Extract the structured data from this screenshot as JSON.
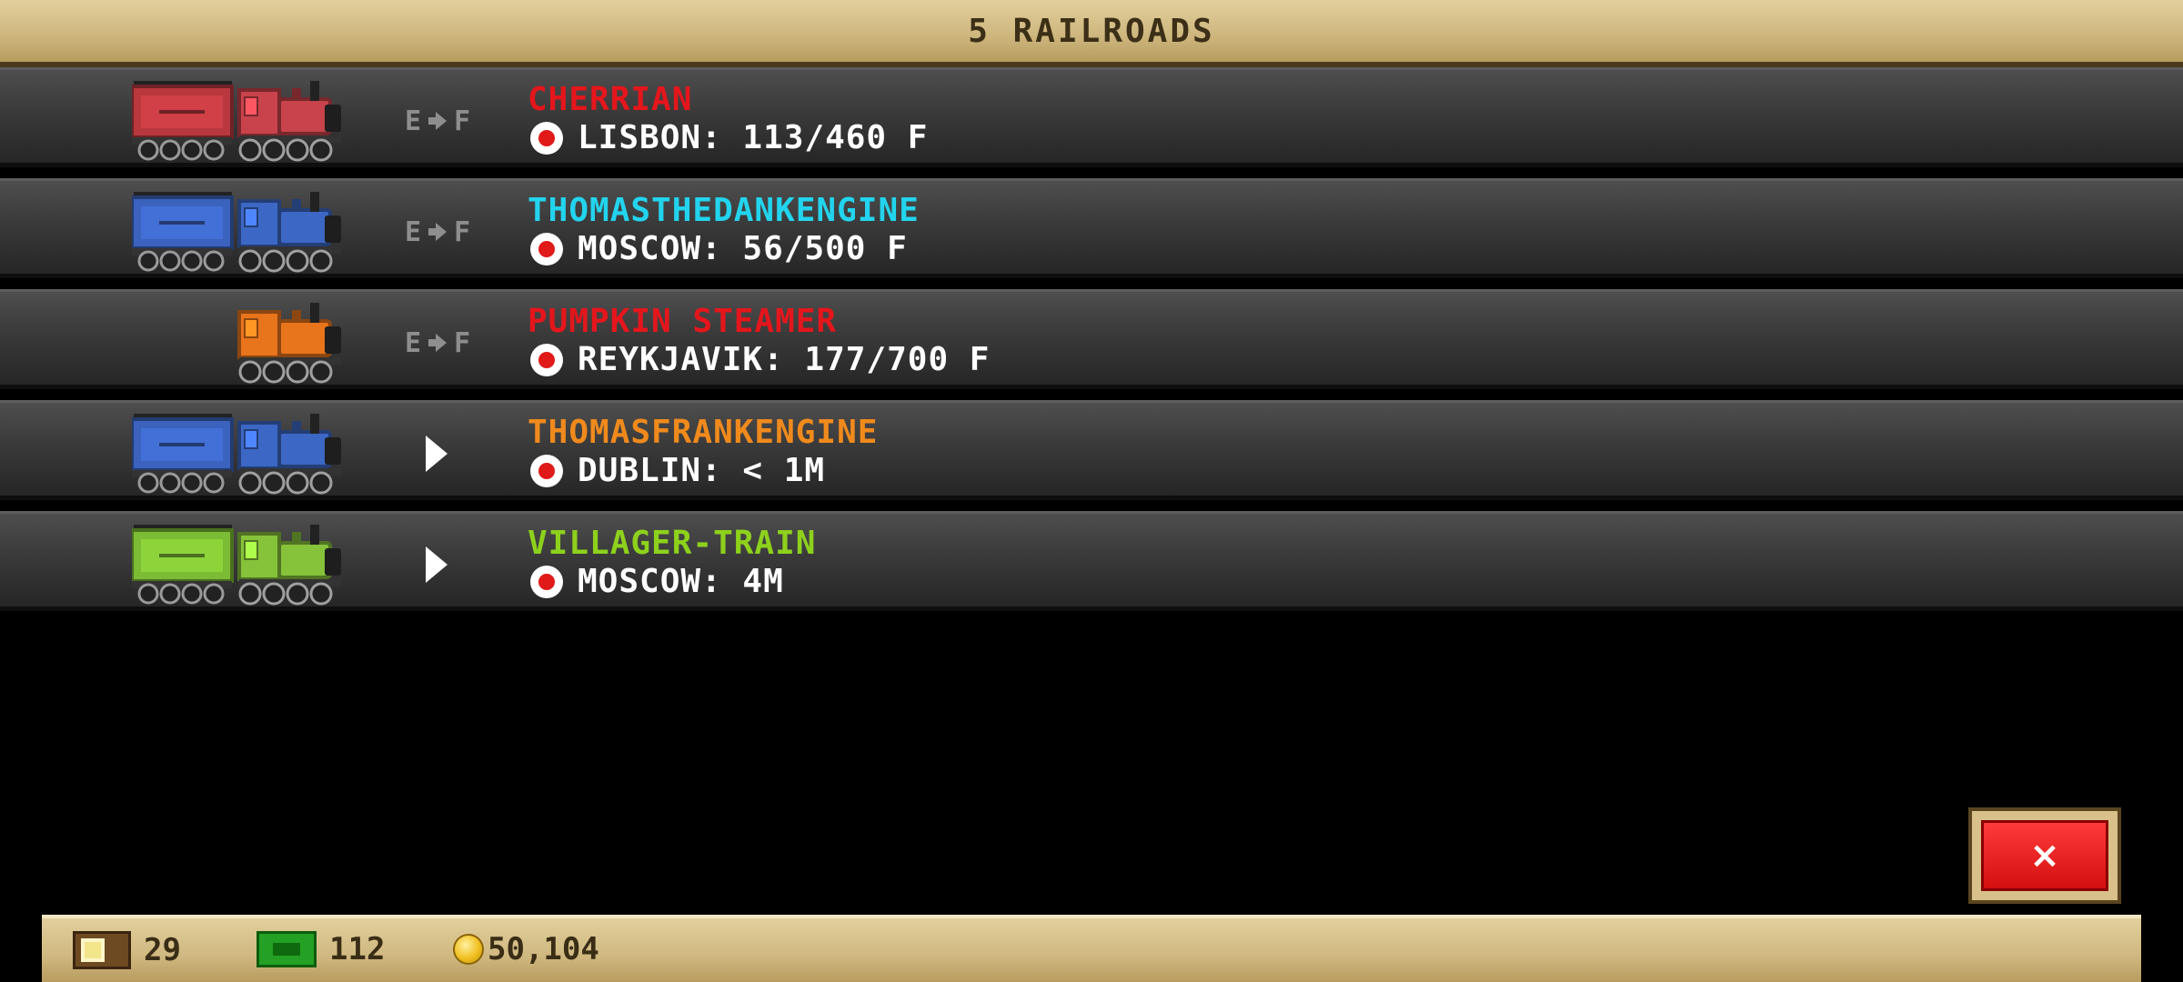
{
  "header": {
    "title": "5 RAILROADS"
  },
  "controls": {
    "ef_left": "E",
    "ef_right": "F"
  },
  "trains": [
    {
      "name": "CHERRIAN",
      "name_color": "#e4161c",
      "status": "LISBON: 113/460 F",
      "control": "ef",
      "tender": true,
      "body_color": "#c8434b",
      "tender_color": "#b8383e"
    },
    {
      "name": "THOMASTHEDANKENGINE",
      "name_color": "#22d4ee",
      "status": "MOSCOW: 56/500 F",
      "control": "ef",
      "tender": true,
      "body_color": "#3c67c4",
      "tender_color": "#3b63bd"
    },
    {
      "name": "PUMPKIN STEAMER",
      "name_color": "#e4161c",
      "status": "REYKJAVIK: 177/700 F",
      "control": "ef",
      "tender": false,
      "body_color": "#e8741c",
      "tender_color": "#e8741c"
    },
    {
      "name": "THOMASFRANKENGINE",
      "name_color": "#f08a1c",
      "status": "DUBLIN: < 1M",
      "control": "play",
      "tender": true,
      "body_color": "#3c67c4",
      "tender_color": "#3b63bd"
    },
    {
      "name": "VILLAGER-TRAIN",
      "name_color": "#8ed11c",
      "status": "MOSCOW: 4M",
      "control": "play",
      "tender": true,
      "body_color": "#86c23a",
      "tender_color": "#7cbb34"
    }
  ],
  "close_button": {
    "glyph": "×"
  },
  "resources": {
    "crates": "29",
    "cash": "112",
    "coins": "50,104"
  }
}
